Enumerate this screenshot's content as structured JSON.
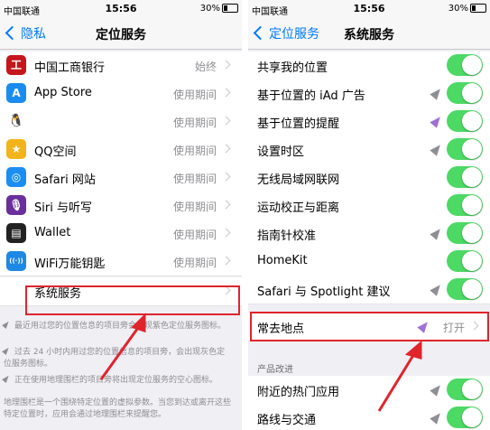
{
  "left": {
    "status": {
      "carrier": "中国联通",
      "time": "15:56",
      "battery": "30%"
    },
    "nav": {
      "back": "隐私",
      "title": "定位服务"
    },
    "rows": [
      {
        "label": "中国工商银行",
        "value": "始终",
        "icon": "bank-icon",
        "color": "#c4161c",
        "glyph": "工"
      },
      {
        "label": "App Store",
        "value": "使用期间",
        "icon": "app-store-icon",
        "color": "#1a8cf0",
        "glyph": "A"
      },
      {
        "label": "",
        "value": "使用期间",
        "icon": "penguin-icon",
        "color": "#ffffff",
        "glyph": "🐧"
      },
      {
        "label": "QQ空间",
        "value": "使用期间",
        "icon": "star-icon",
        "color": "#f3b41b",
        "glyph": "★"
      },
      {
        "label": "Safari 网站",
        "value": "使用期间",
        "icon": "compass-icon",
        "color": "#1b8ef2",
        "glyph": "◎"
      },
      {
        "label": "Siri 与听写",
        "value": "使用期间",
        "icon": "microphone-icon",
        "color": "#6b2f9c",
        "glyph": "🎙"
      },
      {
        "label": "Wallet",
        "value": "使用期间",
        "icon": "wallet-icon",
        "color": "#222222",
        "glyph": "▤"
      },
      {
        "label": "WiFi万能钥匙",
        "value": "使用期间",
        "icon": "wifi-key-icon",
        "color": "#1e88e5",
        "glyph": "((·))"
      },
      {
        "label": "系统服务",
        "value": "",
        "icon": "",
        "color": "",
        "glyph": ""
      }
    ],
    "footer": [
      "最近用过您的位置信息的项目旁会出现紫色定位服务图标。",
      "过去 24 小时内用过您的位置信息的项目旁，会出现灰色定位服务图标。",
      "正在使用地理围栏的项目旁将出现定位服务的空心图标。",
      "地理围栏是一个围绕特定位置的虚拟参数。当您到达或离开这些特定位置时，应用会通过地理围栏来提醒您。"
    ]
  },
  "right": {
    "status": {
      "carrier": "中国联通",
      "time": "15:56",
      "battery": "30%"
    },
    "nav": {
      "back": "定位服务",
      "title": "系统服务"
    },
    "rows": [
      {
        "label": "共享我的位置",
        "loc": ""
      },
      {
        "label": "基于位置的 iAd 广告",
        "loc": "gray"
      },
      {
        "label": "基于位置的提醒",
        "loc": "purple"
      },
      {
        "label": "设置时区",
        "loc": "gray"
      },
      {
        "label": "无线局域网联网",
        "loc": ""
      },
      {
        "label": "运动校正与距离",
        "loc": ""
      },
      {
        "label": "指南针校准",
        "loc": "gray"
      },
      {
        "label": "HomeKit",
        "loc": ""
      },
      {
        "label": "Safari 与 Spotlight 建议",
        "loc": "gray"
      }
    ],
    "frequent": {
      "label": "常去地点",
      "value": "打开"
    },
    "section_title": "产品改进",
    "rows2": [
      {
        "label": "附近的热门应用",
        "loc": "gray"
      },
      {
        "label": "路线与交通",
        "loc": "gray"
      }
    ]
  },
  "colors": {
    "accent": "#007aff",
    "toggle_on": "#4cd964",
    "highlight": "#e0242c"
  }
}
